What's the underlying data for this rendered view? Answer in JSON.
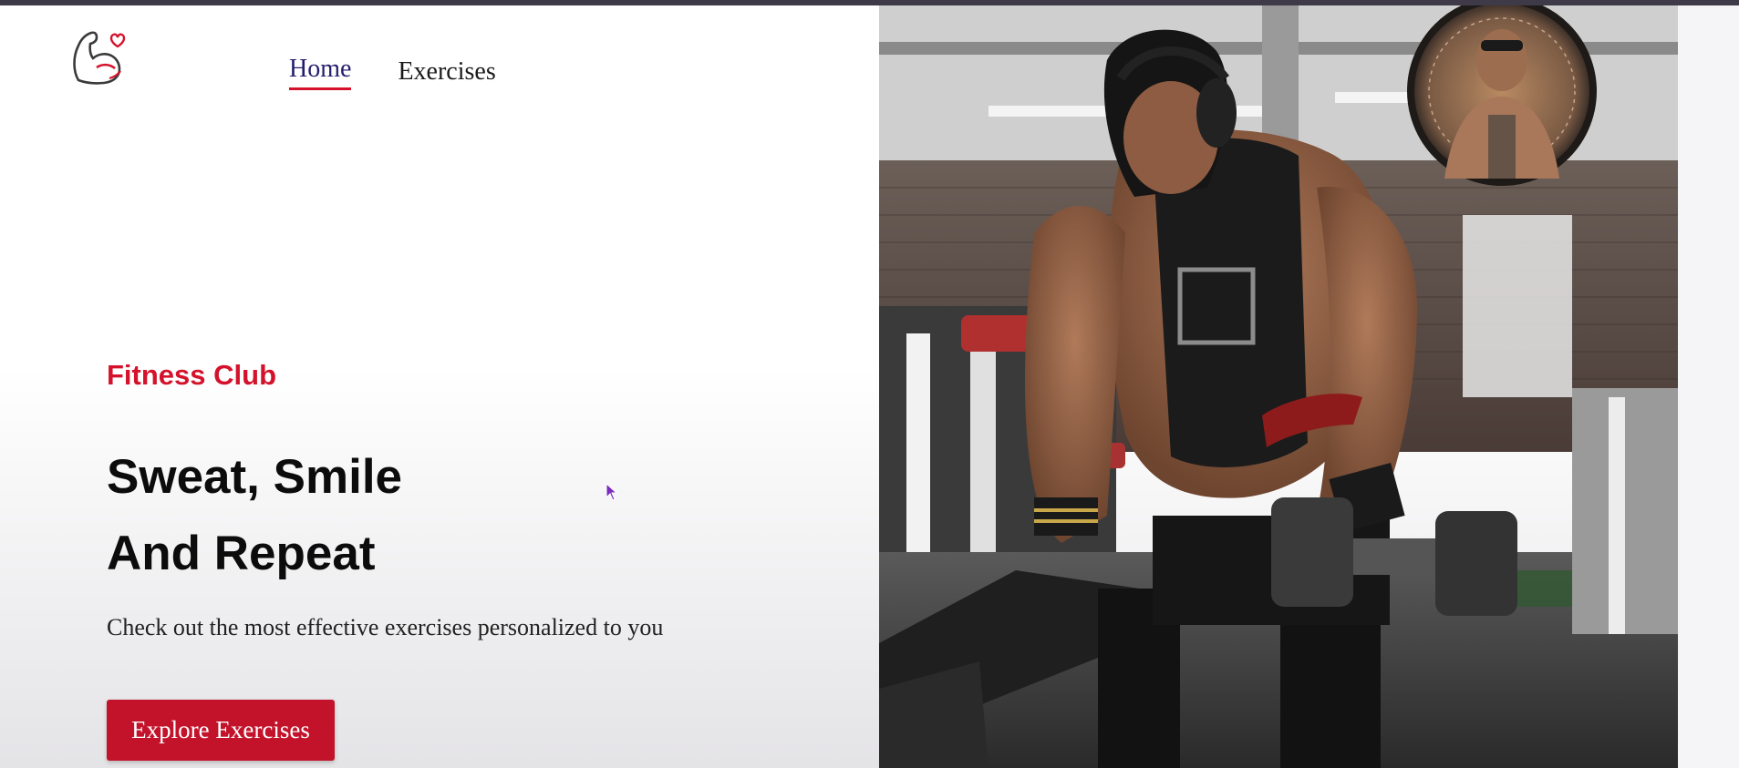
{
  "nav": {
    "items": [
      {
        "label": "Home",
        "active": true
      },
      {
        "label": "Exercises",
        "active": false
      }
    ]
  },
  "logo": {
    "icon": "flexed-arm-heart-icon"
  },
  "hero": {
    "eyebrow": "Fitness Club",
    "headline_line1": "Sweat, Smile",
    "headline_line2": "And Repeat",
    "subtext": "Check out the most effective exercises personalized to you",
    "cta_label": "Explore Exercises",
    "image_alt": "bodybuilder training with dumbbell in gym",
    "badge_icon": "circular-portrait-badge"
  },
  "colors": {
    "accent": "#d4122b",
    "button": "#c3132b",
    "nav_active": "#231f6b",
    "top_strip": "#3f3a48"
  }
}
